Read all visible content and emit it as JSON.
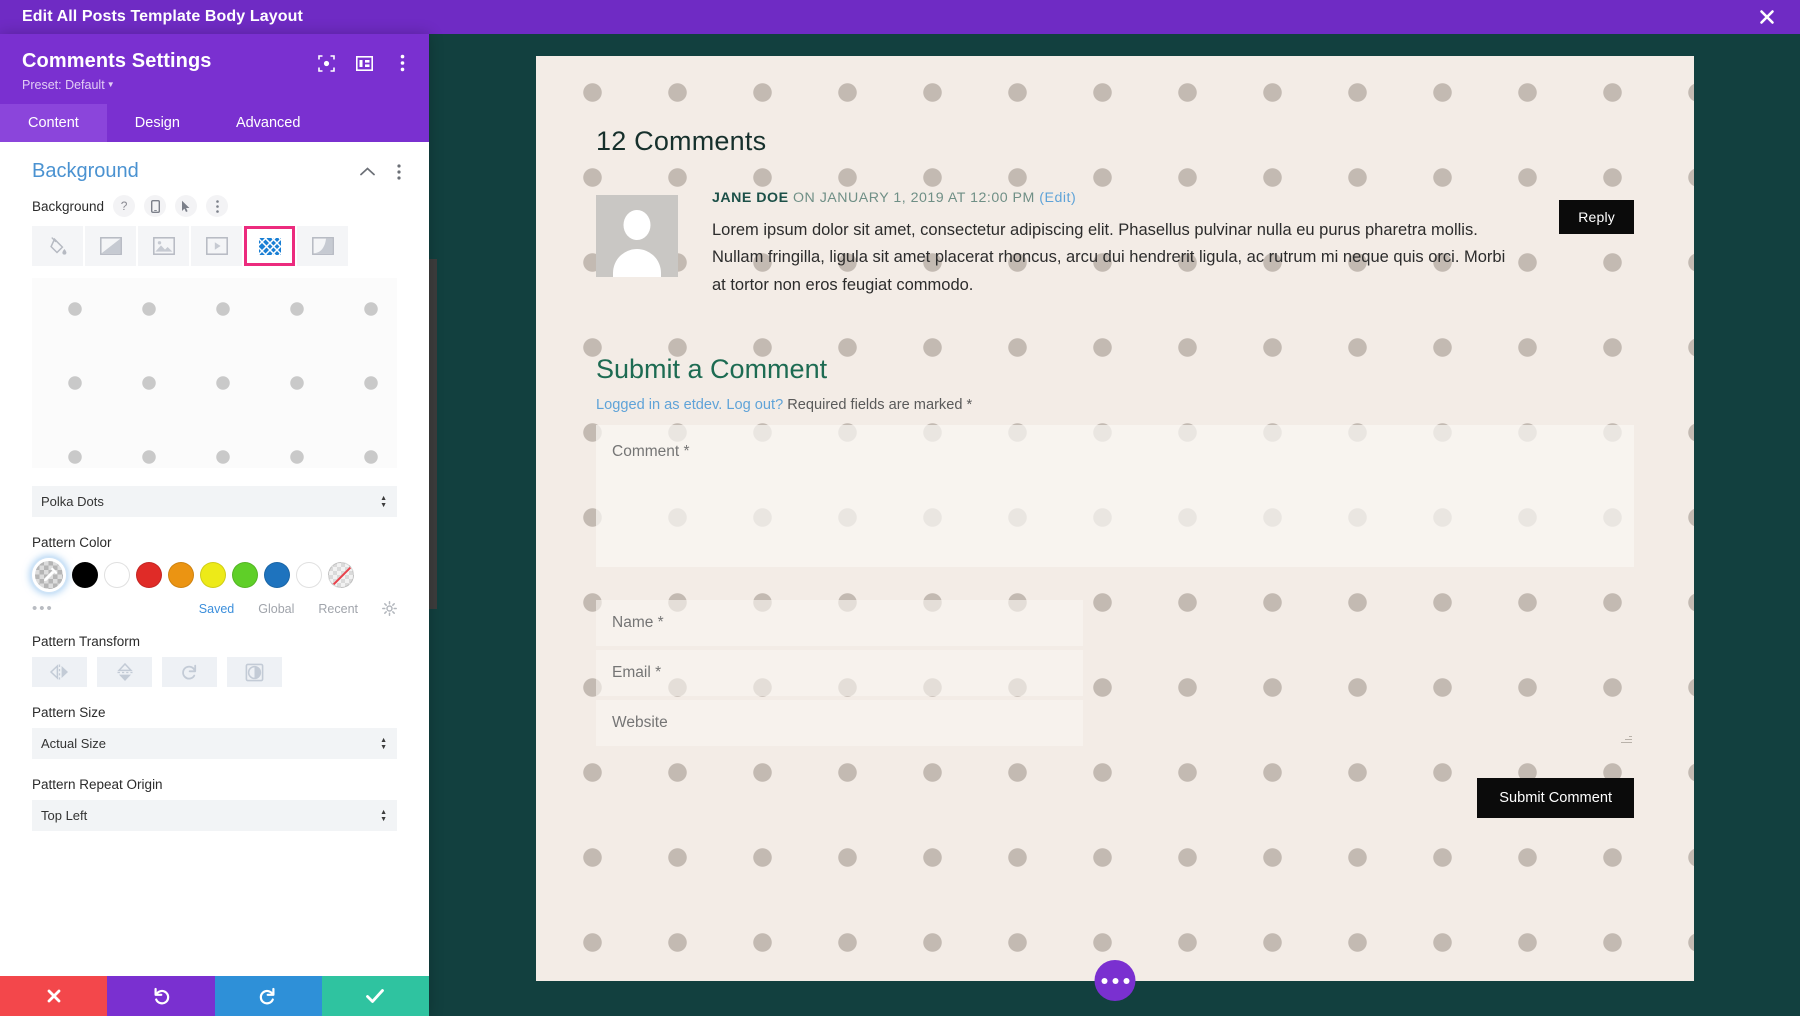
{
  "topbar": {
    "title": "Edit All Posts Template Body Layout",
    "close_icon": "close-icon"
  },
  "panel": {
    "heading": "Comments Settings",
    "preset": "Preset: Default",
    "head_icons": [
      "focus-target-icon",
      "layout-columns-icon",
      "kebab-menu-icon"
    ],
    "tabs": [
      {
        "label": "Content",
        "active": true
      },
      {
        "label": "Design",
        "active": false
      },
      {
        "label": "Advanced",
        "active": false
      }
    ],
    "section": {
      "title": "Background",
      "collapse_icon": "chevron-up-icon",
      "kebab_icon": "kebab-menu-icon"
    },
    "background_field": {
      "label": "Background",
      "icons": [
        "help-icon",
        "mobile-icon",
        "cursor-hover-icon",
        "kebab-menu-icon"
      ],
      "types": [
        {
          "name": "background-color",
          "selected": false
        },
        {
          "name": "background-gradient",
          "selected": false
        },
        {
          "name": "background-image",
          "selected": false
        },
        {
          "name": "background-video",
          "selected": false
        },
        {
          "name": "background-pattern",
          "selected": true
        },
        {
          "name": "background-mask",
          "selected": false
        }
      ]
    },
    "pattern_select": {
      "label": "",
      "value": "Polka Dots"
    },
    "pattern_color": {
      "label": "Pattern Color",
      "swatches": [
        {
          "name": "eyedropper-transparent",
          "color": "transparent",
          "selected": true
        },
        {
          "name": "black",
          "color": "#000000",
          "selected": false
        },
        {
          "name": "white",
          "color": "#ffffff",
          "selected": false
        },
        {
          "name": "red",
          "color": "#e02b27",
          "selected": false
        },
        {
          "name": "orange",
          "color": "#eb9412",
          "selected": false
        },
        {
          "name": "yellow",
          "color": "#edea18",
          "selected": false
        },
        {
          "name": "green",
          "color": "#5fcf28",
          "selected": false
        },
        {
          "name": "blue",
          "color": "#1e73be",
          "selected": false
        },
        {
          "name": "white-outline",
          "color": "#ffffff",
          "selected": false
        },
        {
          "name": "no-color",
          "color": "none",
          "selected": false
        }
      ],
      "more_icon": "more-dots-icon",
      "links": [
        {
          "label": "Saved",
          "active": true
        },
        {
          "label": "Global",
          "active": false
        },
        {
          "label": "Recent",
          "active": false
        }
      ],
      "settings_icon": "gear-icon"
    },
    "pattern_transform": {
      "label": "Pattern Transform",
      "buttons": [
        {
          "name": "flip-horizontal-icon"
        },
        {
          "name": "flip-vertical-icon"
        },
        {
          "name": "rotate-icon"
        },
        {
          "name": "invert-icon"
        }
      ]
    },
    "pattern_size": {
      "label": "Pattern Size",
      "value": "Actual Size"
    },
    "pattern_repeat_origin": {
      "label": "Pattern Repeat Origin",
      "value": "Top Left"
    },
    "actions": [
      {
        "name": "cancel-button",
        "icon": "close-icon",
        "color": "#f3474b"
      },
      {
        "name": "undo-button",
        "icon": "undo-icon",
        "color": "#7a30d0"
      },
      {
        "name": "redo-button",
        "icon": "redo-icon",
        "color": "#2e90d8"
      },
      {
        "name": "save-button",
        "icon": "check-icon",
        "color": "#2fc3a0"
      }
    ]
  },
  "canvas": {
    "comments_count": "12 Comments",
    "comment": {
      "author": "JANE DOE",
      "meta": " ON JANUARY 1, 2019 AT 12:00 PM ",
      "edit_link": "(Edit)",
      "body": "Lorem ipsum dolor sit amet, consectetur adipiscing elit. Phasellus pulvinar nulla eu purus pharetra mollis. Nullam fringilla, ligula sit amet placerat rhoncus, arcu dui hendrerit ligula, ac rutrum mi neque quis orci. Morbi at tortor non eros feugiat commodo.",
      "reply_label": "Reply"
    },
    "submit_title": "Submit a Comment",
    "logged_in_prefix": "Logged in as etdev.",
    "logout_link": "Log out?",
    "required_note": " Required fields are marked *",
    "fields": {
      "comment_placeholder": "Comment *",
      "name_placeholder": "Name *",
      "email_placeholder": "Email *",
      "website_placeholder": "Website"
    },
    "submit_label": "Submit Comment",
    "fab_icon": "more-options-icon"
  }
}
